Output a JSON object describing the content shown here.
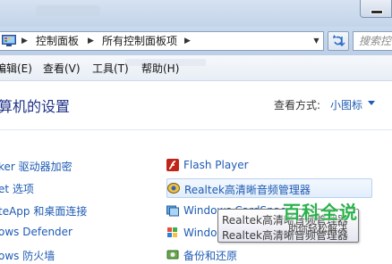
{
  "address_bar": {
    "breadcrumbs": [
      "控制面板",
      "所有控制面板项"
    ],
    "search_placeholder": "搜索控"
  },
  "menu": {
    "items": [
      "编辑(E)",
      "查看(V)",
      "工具(T)",
      "帮助(H)"
    ]
  },
  "header": {
    "title": "算机的设置",
    "view_by_label": "查看方式:",
    "view_by_value": "小图标"
  },
  "left_column": [
    "ker 驱动器加密",
    "et 选项",
    "teApp 和桌面连接",
    "ows Defender",
    "ows 防火墙"
  ],
  "right_column": [
    {
      "label": "Flash Player",
      "icon": "flash-icon"
    },
    {
      "label": "Realtek高清晰音频管理器",
      "icon": "realtek-speaker-icon"
    },
    {
      "label": "Windows CardSpace",
      "icon": "cardspace-icon"
    },
    {
      "label": "Windows Update",
      "icon": "windows-update-icon"
    },
    {
      "label": "备份和还原",
      "icon": "backup-restore-icon"
    }
  ],
  "tooltip": {
    "line1": "Realtek高清晰音频管理器",
    "line2": "Realtek高清晰音频管理器"
  },
  "watermark": {
    "title": "百科全说",
    "subtitle": "助你轻松解决"
  },
  "colors": {
    "link": "#1e5bb3",
    "heading": "#1e3287",
    "watermark": "#2bb24c"
  }
}
